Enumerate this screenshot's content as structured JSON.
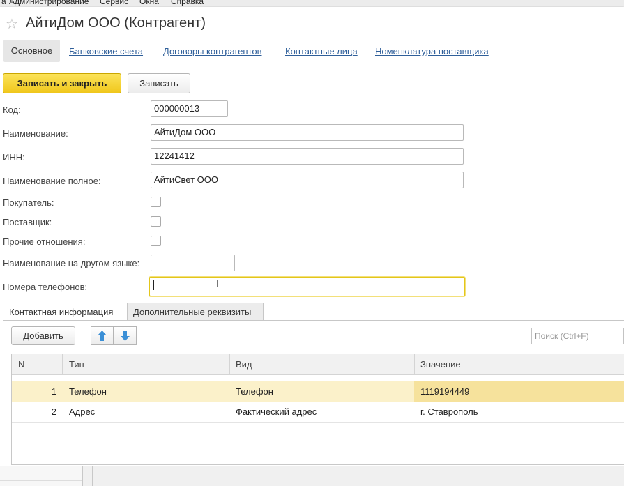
{
  "menu": [
    "а",
    "Администрирование",
    "Сервис",
    "Окна",
    "Справка"
  ],
  "window": {
    "title": "АйтиДом ООО (Контрагент)",
    "tabs": [
      "Основное",
      "Банковские счета",
      "Договоры контрагентов",
      "Контактные лица",
      "Номенклатура поставщика"
    ]
  },
  "toolbar": {
    "save_close": "Записать и закрыть",
    "save": "Записать"
  },
  "form": {
    "code_label": "Код:",
    "code_value": "000000013",
    "name_label": "Наименование:",
    "name_value": "АйтиДом ООО",
    "inn_label": "ИНН:",
    "inn_value": "12241412",
    "fullname_label": "Наименование полное:",
    "fullname_value": "АйтиСвет ООО",
    "buyer_label": "Покупатель:",
    "buyer_checked": false,
    "supplier_label": "Поставщик:",
    "supplier_checked": false,
    "other_label": "Прочие отношения:",
    "other_checked": false,
    "otherlang_label": "Наименование на другом языке:",
    "otherlang_value": "",
    "phones_label": "Номера телефонов:",
    "phones_value": ""
  },
  "subtabs": [
    "Контактная информация",
    "Дополнительные реквизиты"
  ],
  "contacts": {
    "add_label": "Добавить",
    "up_icon": "arrow-up-icon",
    "down_icon": "arrow-down-icon",
    "search_placeholder": "Поиск (Ctrl+F)",
    "columns": [
      "N",
      "Тип",
      "Вид",
      "Значение"
    ],
    "rows": [
      {
        "n": "1",
        "type": "Телефон",
        "kind": "Телефон",
        "value": "1119194449"
      },
      {
        "n": "2",
        "type": "Адрес",
        "kind": "Фактический адрес",
        "value": "г. Ставрополь"
      }
    ]
  },
  "colors": {
    "accent": "#f5d326",
    "link": "#2f5f9a",
    "selected_row": "#fbf1ca"
  }
}
